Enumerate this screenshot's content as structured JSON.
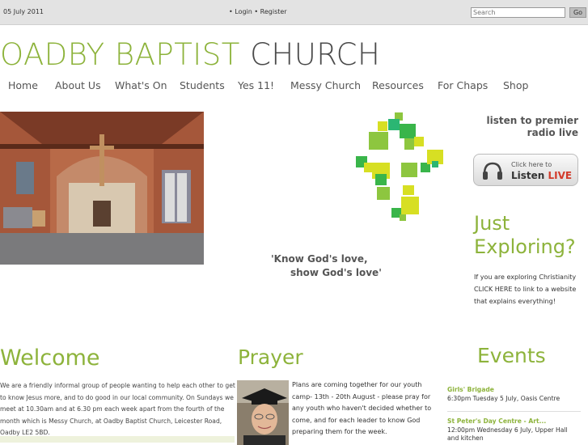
{
  "topbar": {
    "date": "05 July 2011",
    "links": "• Login • Register",
    "search_placeholder": "Search",
    "go_label": "Go"
  },
  "site": {
    "title_part1": "OADBY BAPTIST",
    "title_part2": "CHURCH"
  },
  "nav": {
    "items": [
      "Home",
      "About Us",
      "What's On",
      "Students",
      "Yes 11!",
      "Messy Church",
      "Resources",
      "For Chaps",
      "Shop"
    ]
  },
  "tagline": {
    "line1": "'Know God's love,",
    "line2": "show God's love'"
  },
  "premier": {
    "line1": "listen to premier",
    "line2": "radio live",
    "button_small": "Click here to",
    "button_big": "Listen",
    "button_live": "LIVE"
  },
  "exploring": {
    "line1": "Just",
    "line2": "Exploring?",
    "text": "If you are exploring Christianity CLICK HERE to link to a website that explains everything!"
  },
  "welcome": {
    "heading": "Welcome",
    "text": "We are a friendly informal group of people wanting to help each other to get to know Jesus more, and to do good in our local community. On Sundays we meet at 10.30am and at 6.30 pm each week apart from the fourth of the month which is Messy Church, at Oadby Baptist Church, Leicester Road, Oadby LE2 5BD."
  },
  "prayer": {
    "heading": "Prayer",
    "text": "Plans are coming together for our youth camp- 13th - 20th August - please pray for any youth who haven't decided whether to come, and for each leader to know God preparing them for the week."
  },
  "events": {
    "heading": "Events",
    "items": [
      {
        "title": "Girls' Brigade",
        "detail": "6:30pm Tuesday 5 July, Oasis Centre"
      },
      {
        "title": "St Peter's Day Centre - Art...",
        "detail": "12:00pm Wednesday 6 July, Upper Hall and kitchen"
      }
    ]
  },
  "colors": {
    "accent_green": "#8db33b",
    "topbar_bg": "#e3e3e3",
    "live_red": "#d23a2a"
  }
}
